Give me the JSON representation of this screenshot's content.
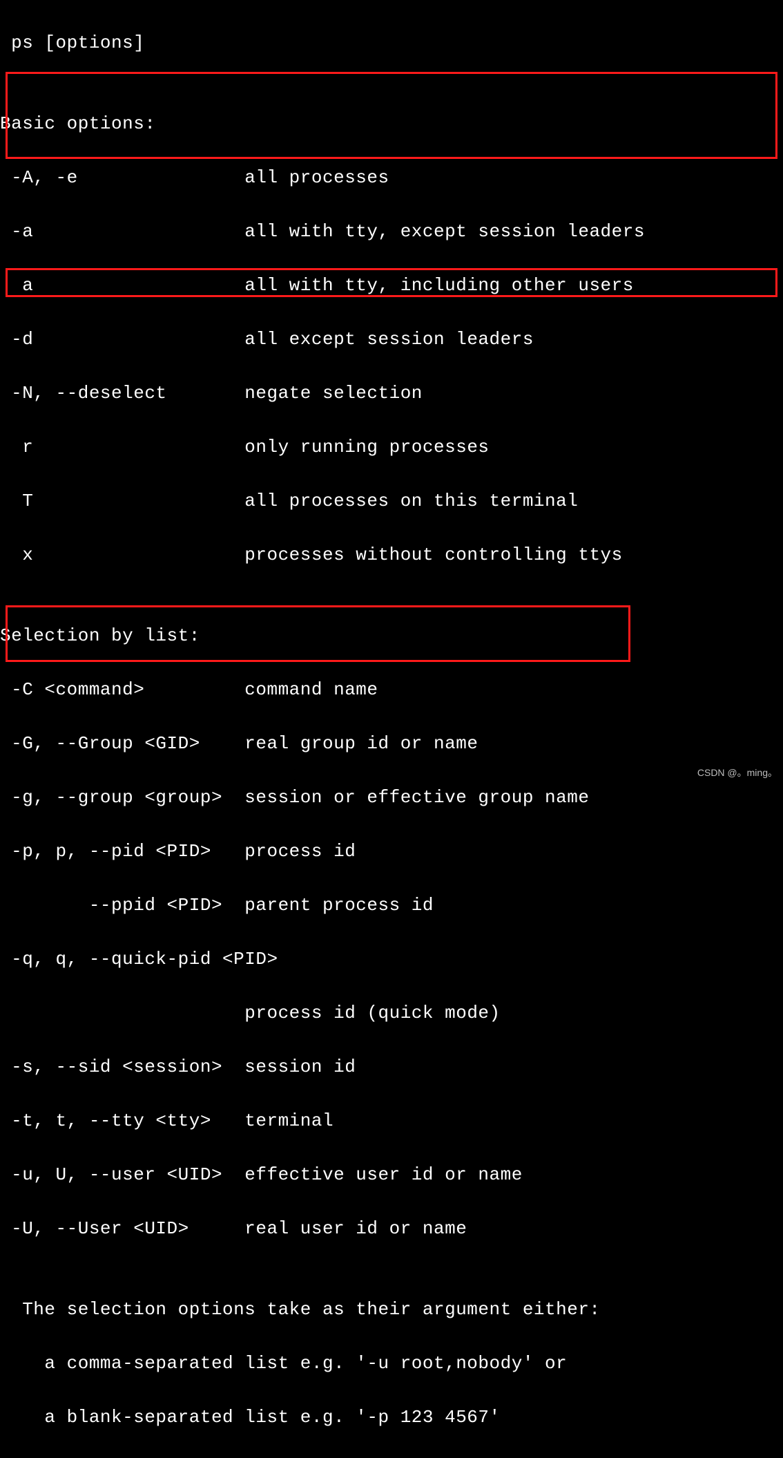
{
  "header": " ps [options]",
  "blank": "",
  "basic_header": "Basic options:",
  "basic": [
    {
      "opt": " -A, -e               ",
      "desc": "all processes"
    },
    {
      "opt": " -a                   ",
      "desc": "all with tty, except session leaders"
    },
    {
      "opt": "  a                   ",
      "desc": "all with tty, including other users"
    },
    {
      "opt": " -d                   ",
      "desc": "all except session leaders"
    },
    {
      "opt": " -N, --deselect       ",
      "desc": "negate selection"
    },
    {
      "opt": "  r                   ",
      "desc": "only running processes"
    },
    {
      "opt": "  T                   ",
      "desc": "all processes on this terminal"
    },
    {
      "opt": "  x                   ",
      "desc": "processes without controlling ttys"
    }
  ],
  "selection_header": "Selection by list:",
  "selection": [
    {
      "opt": " -C <command>         ",
      "desc": "command name"
    },
    {
      "opt": " -G, --Group <GID>    ",
      "desc": "real group id or name"
    },
    {
      "opt": " -g, --group <group>  ",
      "desc": "session or effective group name"
    },
    {
      "opt": " -p, p, --pid <PID>   ",
      "desc": "process id"
    },
    {
      "opt": "        --ppid <PID>  ",
      "desc": "parent process id"
    },
    {
      "opt": " -q, q, --quick-pid <PID>",
      "desc": ""
    },
    {
      "opt": "                      ",
      "desc": "process id (quick mode)"
    },
    {
      "opt": " -s, --sid <session>  ",
      "desc": "session id"
    },
    {
      "opt": " -t, t, --tty <tty>   ",
      "desc": "terminal"
    },
    {
      "opt": " -u, U, --user <UID>  ",
      "desc": "effective user id or name"
    },
    {
      "opt": " -U, --User <UID>     ",
      "desc": "real user id or name"
    }
  ],
  "footer": [
    "  The selection options take as their argument either:",
    "    a comma-separated list e.g. '-u root,nobody' or",
    "    a blank-separated list e.g. '-p 123 4567'"
  ],
  "watermark": "CSDN @。ming。"
}
